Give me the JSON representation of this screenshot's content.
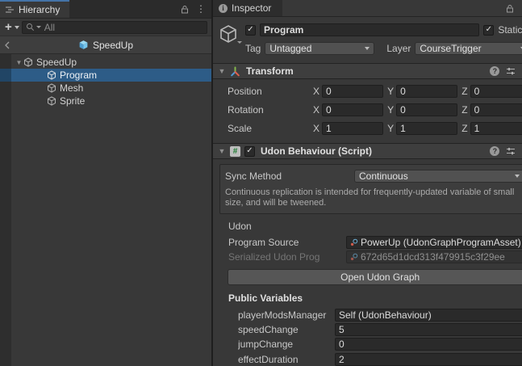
{
  "hierarchy": {
    "tab_label": "Hierarchy",
    "search_placeholder": "All",
    "breadcrumb_title": "SpeedUp",
    "tree": [
      {
        "label": "SpeedUp"
      },
      {
        "label": "Program"
      },
      {
        "label": "Mesh"
      },
      {
        "label": "Sprite"
      }
    ]
  },
  "inspector": {
    "tab_label": "Inspector",
    "gameobject": {
      "name": "Program",
      "static_label": "Static",
      "tag_label": "Tag",
      "tag_value": "Untagged",
      "layer_label": "Layer",
      "layer_value": "CourseTrigger"
    },
    "transform": {
      "title": "Transform",
      "axis_labels": [
        "X",
        "Y",
        "Z"
      ],
      "rows": [
        {
          "label": "Position",
          "x": "0",
          "y": "0",
          "z": "0"
        },
        {
          "label": "Rotation",
          "x": "0",
          "y": "0",
          "z": "0"
        },
        {
          "label": "Scale",
          "x": "1",
          "y": "1",
          "z": "1"
        }
      ]
    },
    "udon": {
      "title": "Udon Behaviour (Script)",
      "script_icon_glyph": "#",
      "sync_method_label": "Sync Method",
      "sync_method_value": "Continuous",
      "sync_description": "Continuous replication is intended for frequently-updated variable of small size, and will be tweened.",
      "section_label": "Udon",
      "program_source_label": "Program Source",
      "program_source_value": "PowerUp (UdonGraphProgramAsset)",
      "serialized_program_label": "Serialized Udon Prog",
      "serialized_program_value": "672d65d1dcd313f479915c3f29ee",
      "open_graph_button": "Open Udon Graph",
      "public_variables_label": "Public Variables",
      "public_variables": [
        {
          "name": "playerModsManager",
          "value": "Self (UdonBehaviour)"
        },
        {
          "name": "speedChange",
          "value": "5"
        },
        {
          "name": "jumpChange",
          "value": "0"
        },
        {
          "name": "effectDuration",
          "value": "2"
        }
      ]
    }
  },
  "icons": {
    "menu_dots": "⋮",
    "object_picker": "◎",
    "check": "✓",
    "foldout_open": "▼"
  },
  "colors": {
    "selection_blue": "#2d5c87",
    "focus_line_blue": "#4473a7",
    "prefab_blue": "#6cc2ea"
  }
}
